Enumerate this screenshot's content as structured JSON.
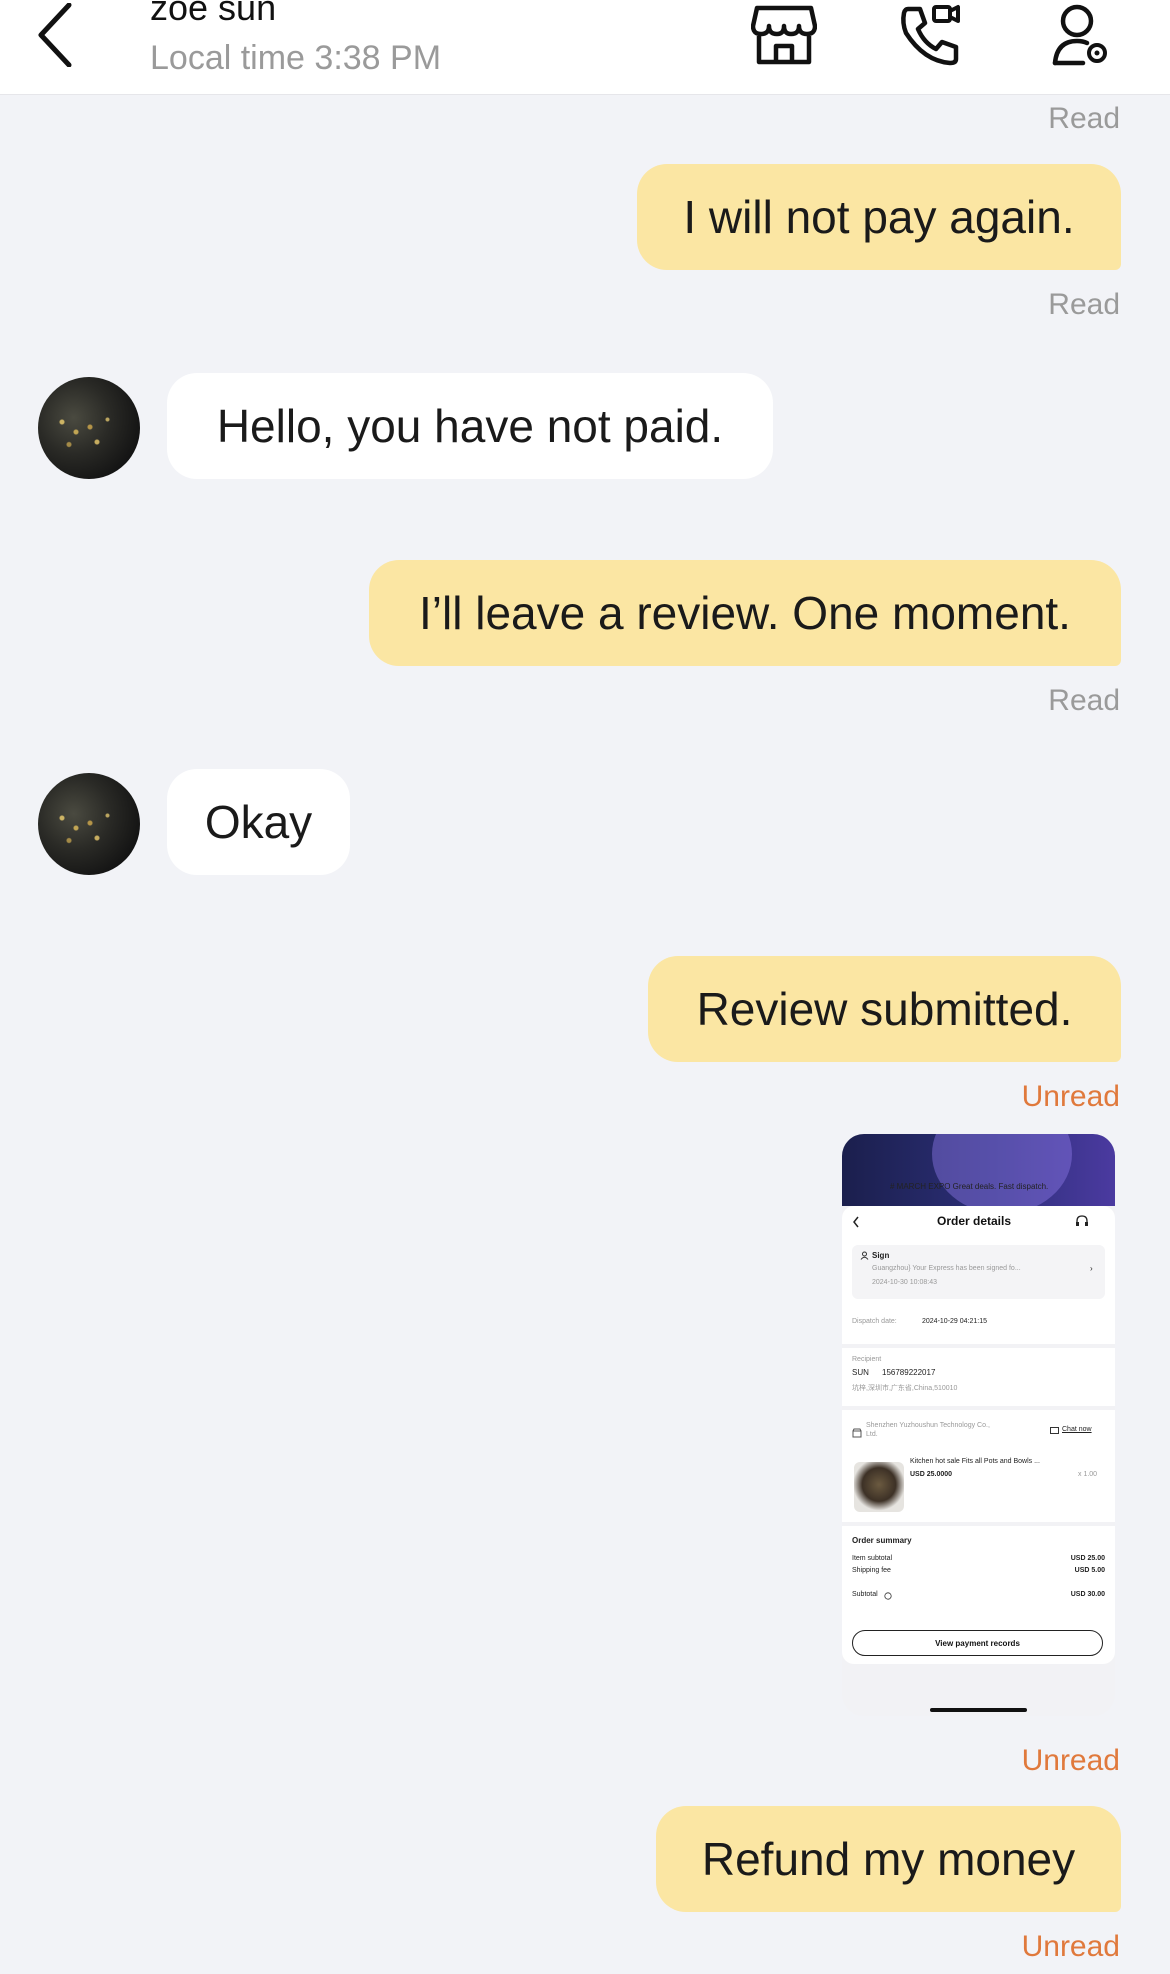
{
  "header": {
    "contact_name": "zoe sun",
    "local_time": "Local time 3:38 PM",
    "icons": [
      "back-icon",
      "store-icon",
      "video-call-icon",
      "contact-settings-icon"
    ]
  },
  "messages": [
    {
      "type": "status",
      "text": "Read"
    },
    {
      "type": "outgoing",
      "text": "I will not pay again."
    },
    {
      "type": "status",
      "text": "Read"
    },
    {
      "type": "incoming",
      "text": "Hello, you have not paid."
    },
    {
      "type": "outgoing",
      "text": "I’ll leave a review. One moment."
    },
    {
      "type": "status",
      "text": "Read"
    },
    {
      "type": "incoming",
      "text": "Okay"
    },
    {
      "type": "outgoing",
      "text": "Review submitted."
    },
    {
      "type": "status",
      "text": "Unread"
    },
    {
      "type": "outgoing-image",
      "text": ""
    },
    {
      "type": "status",
      "text": "Unread"
    },
    {
      "type": "outgoing",
      "text": "Refund my money"
    },
    {
      "type": "status",
      "text": "Unread"
    }
  ],
  "screenshot": {
    "banner_text": "# MARCH EXPO   Great deals. Fast dispatch.",
    "title": "Order details",
    "sign_label": "Sign",
    "sign_detail": "Guangzhou} Your Express has been signed fo...",
    "sign_time": "2024-10-30 10:08:43",
    "dispatch_label": "Dispatch date:",
    "dispatch_value": "2024-10-29 04:21:15",
    "recipient_label": "Recipient",
    "recipient_name": "SUN",
    "recipient_phone": "156789222017",
    "recipient_address": "坑梓,深圳市,广东省,China,510010",
    "seller_name": "Shenzhen Yuzhoushun Technology Co.,",
    "seller_name_2": "Ltd.",
    "chat_now": "Chat now",
    "product_name": "Kitchen hot sale Fits all Pots and Bowls ...",
    "product_price": "USD 25.0000",
    "product_qty": "x 1.00",
    "summary_title": "Order summary",
    "item_subtotal_label": "Item subtotal",
    "item_subtotal_value": "USD 25.00",
    "shipping_label": "Shipping fee",
    "shipping_value": "USD 5.00",
    "subtotal_label": "Subtotal",
    "subtotal_value": "USD 30.00",
    "view_payment": "View payment records"
  },
  "colors": {
    "outgoing_bubble": "#fbe6a3",
    "incoming_bubble": "#ffffff",
    "unread_status": "#e0793c",
    "read_status": "#9a9a9a",
    "background": "#f2f3f7"
  }
}
